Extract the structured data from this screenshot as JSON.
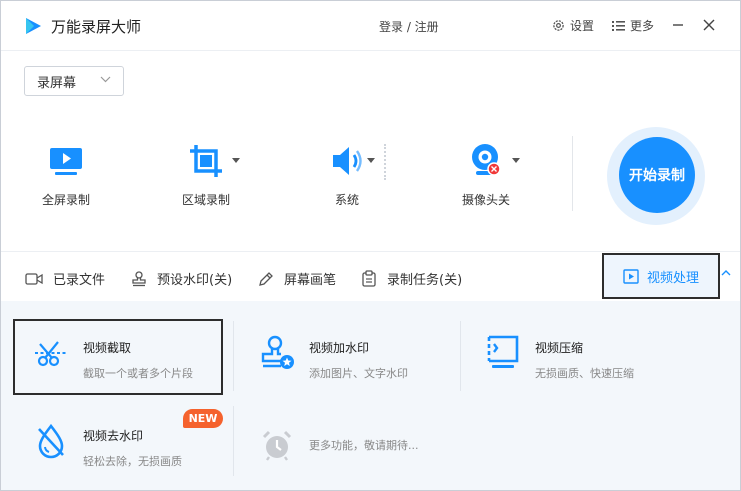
{
  "app": {
    "title": "万能录屏大师",
    "login_label": "登录 / 注册",
    "settings_label": "设置",
    "more_label": "更多"
  },
  "mode_select": {
    "value": "录屏幕"
  },
  "tools": [
    {
      "label": "全屏录制"
    },
    {
      "label": "区域录制"
    },
    {
      "label": "系统"
    },
    {
      "label": "摄像头关"
    }
  ],
  "start_button": {
    "label": "开始录制"
  },
  "tabs": [
    {
      "label": "已录文件"
    },
    {
      "label": "预设水印(关)"
    },
    {
      "label": "屏幕画笔"
    },
    {
      "label": "录制任务(关)"
    },
    {
      "label": "视频处理"
    }
  ],
  "features": [
    {
      "title": "视频截取",
      "desc": "截取一个或者多个片段"
    },
    {
      "title": "视频加水印",
      "desc": "添加图片、文字水印"
    },
    {
      "title": "视频压缩",
      "desc": "无损画质、快速压缩"
    },
    {
      "title": "视频去水印",
      "desc": "轻松去除，无损画质"
    },
    {
      "title": "",
      "desc": "更多功能，敬请期待..."
    }
  ],
  "badge": {
    "new": "NEW"
  },
  "colors": {
    "accent": "#1890ff",
    "panel_bg": "#f3f7fb",
    "badge": "#f5622d"
  }
}
